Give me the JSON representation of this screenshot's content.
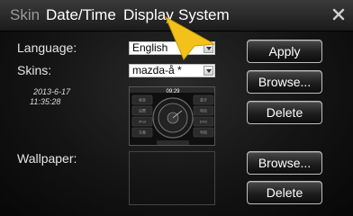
{
  "tabs": [
    "Skin",
    "Date/Time",
    "Display",
    "System"
  ],
  "active_tab": "Display",
  "language": {
    "label": "Language:",
    "value": "English"
  },
  "skins": {
    "label": "Skins:",
    "value": "mazda-å *"
  },
  "skin_meta": {
    "date": "2013-6-17",
    "time": "11:35:28"
  },
  "wallpaper": {
    "label": "Wallpaper:"
  },
  "buttons": {
    "apply": "Apply",
    "browse": "Browse...",
    "delete": "Delete"
  },
  "preview": {
    "clock": "09:29",
    "menu": [
      "收音",
      "蓝牙",
      "设置",
      "电话",
      "导航",
      "DVD",
      "iPod",
      "车载"
    ]
  },
  "colors": {
    "accent_cursor": "#f2c21a",
    "background": "#141414"
  }
}
